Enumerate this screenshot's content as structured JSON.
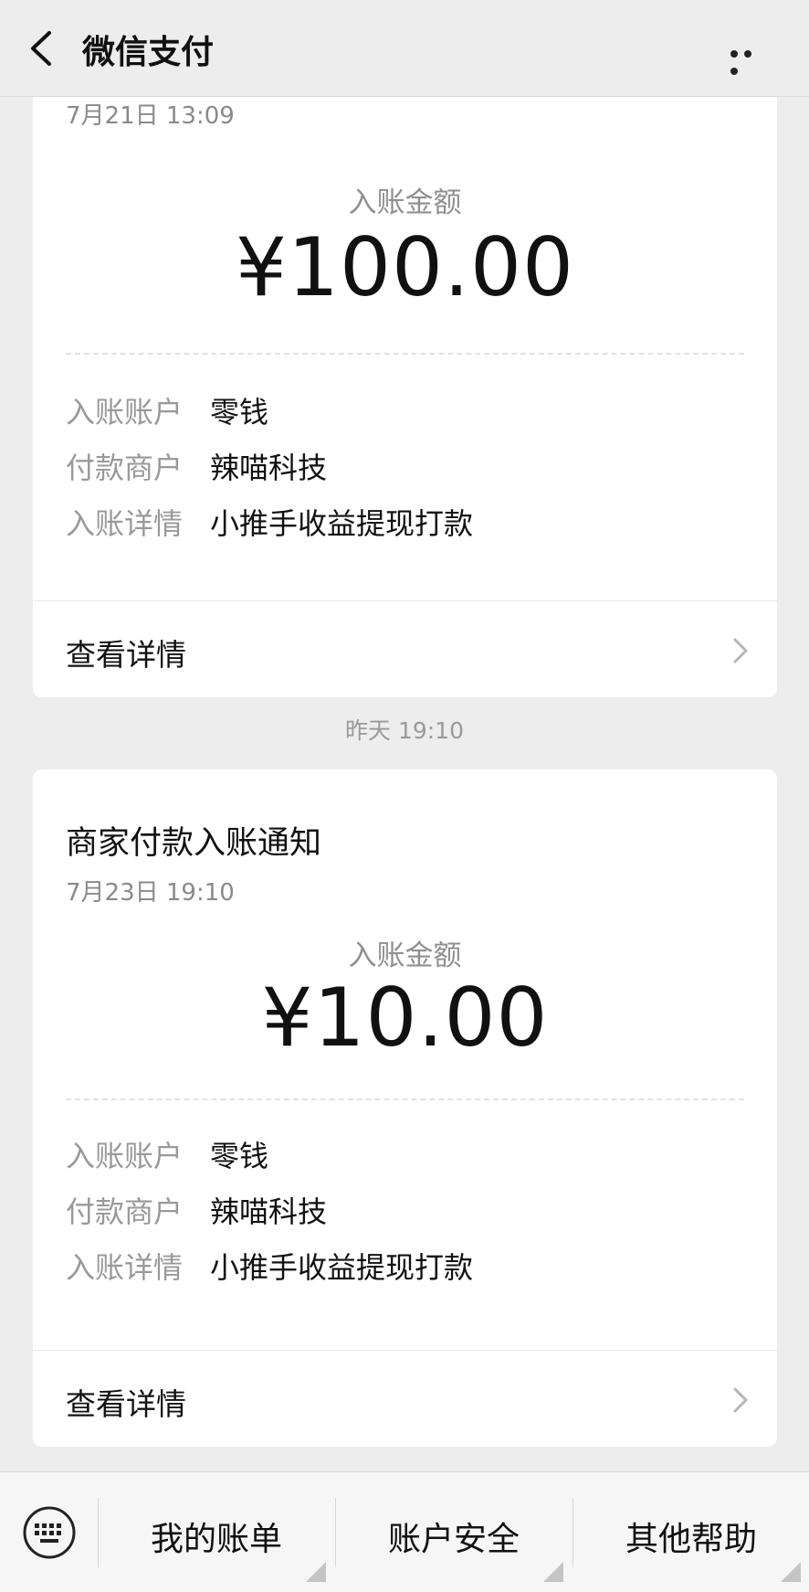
{
  "header": {
    "title": "微信支付"
  },
  "messages": [
    {
      "date": "7月21日 13:09",
      "amount_label": "入账金额",
      "amount": "¥100.00",
      "rows": [
        {
          "key": "入账账户",
          "value": "零钱"
        },
        {
          "key": "付款商户",
          "value": "辣喵科技"
        },
        {
          "key": "入账详情",
          "value": "小推手收益提现打款"
        }
      ],
      "detail_label": "查看详情"
    },
    {
      "time_divider": "昨天 19:10",
      "title": "商家付款入账通知",
      "date": "7月23日  19:10",
      "amount_label": "入账金额",
      "amount": "¥10.00",
      "rows": [
        {
          "key": "入账账户",
          "value": "零钱"
        },
        {
          "key": "付款商户",
          "value": "辣喵科技"
        },
        {
          "key": "入账详情",
          "value": "小推手收益提现打款"
        }
      ],
      "detail_label": "查看详情"
    }
  ],
  "bottom_menu": {
    "items": [
      {
        "label": "我的账单"
      },
      {
        "label": "账户安全"
      },
      {
        "label": "其他帮助"
      }
    ]
  },
  "icons": {
    "back": "chevron-left-icon",
    "more": "more-dots-icon",
    "keyboard": "keyboard-icon",
    "chevron": "chevron-right-icon"
  }
}
